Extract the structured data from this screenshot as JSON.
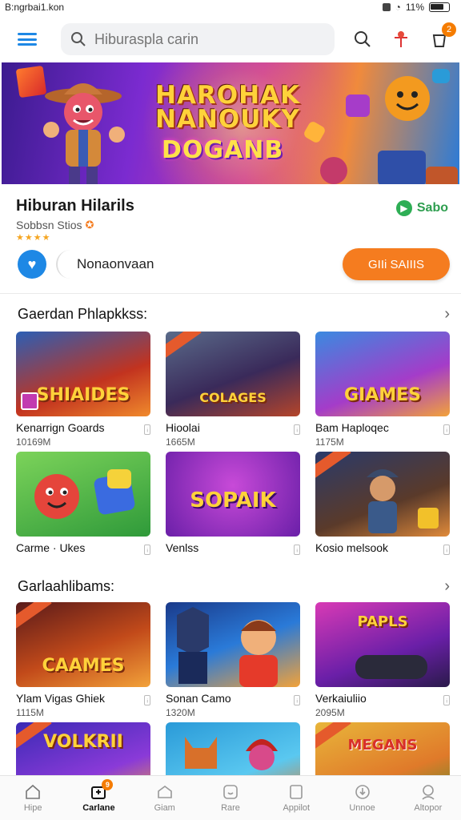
{
  "status_bar": {
    "left_text": "B:ngrbai1.kon",
    "battery": "11%"
  },
  "app_bar": {
    "search_placeholder": "Hiburaspla carin",
    "cart_badge": "2"
  },
  "banner": {
    "title_line1": "HAROHAK",
    "title_line2": "NANOUKY",
    "subtitle": "DOGANB"
  },
  "app": {
    "title": "Hiburan Hilarils",
    "subtitle": "Sobbsn Stios",
    "price": "Sabo",
    "secondary_label": "Nonaonvaan",
    "get_label": "GIIi SAIIIS"
  },
  "sections": [
    {
      "title": "Gaerdan Phlapkkss:",
      "items": [
        {
          "name": "Kenarrign Goards",
          "size": "10169M",
          "thumb_text": "SHIAIDES"
        },
        {
          "name": "Hioolai",
          "size": "1665M",
          "thumb_text": "COLAGES"
        },
        {
          "name": "Bam Haploqec",
          "size": "1175M",
          "thumb_text": "GIAMES"
        },
        {
          "name": "Carme · Ukes",
          "size": "",
          "thumb_text": ""
        },
        {
          "name": "Venlss",
          "size": "",
          "thumb_text": "SOPAIK"
        },
        {
          "name": "Kosio melsook",
          "size": "",
          "thumb_text": ""
        }
      ]
    },
    {
      "title": "Garlaahlibams:",
      "items": [
        {
          "name": "Ylam Vigas Ghiek",
          "size": "1115M",
          "thumb_text": "CAAMES"
        },
        {
          "name": "Sonan Camo",
          "size": "1320M",
          "thumb_text": ""
        },
        {
          "name": "Verkaiuliio",
          "size": "2095M",
          "thumb_text": "PAPLS"
        },
        {
          "name": "",
          "size": "",
          "thumb_text": "VOLKRII"
        },
        {
          "name": "",
          "size": "",
          "thumb_text": ""
        },
        {
          "name": "",
          "size": "",
          "thumb_text": "MEGANS"
        }
      ]
    }
  ],
  "bottom_nav": [
    {
      "label": "Hipe",
      "icon": "home-icon"
    },
    {
      "label": "Carlane",
      "icon": "games-icon",
      "badge": "9"
    },
    {
      "label": "Giam",
      "icon": "apps-icon"
    },
    {
      "label": "Rare",
      "icon": "face-icon"
    },
    {
      "label": "Appilot",
      "icon": "bookmark-icon"
    },
    {
      "label": "Unnoe",
      "icon": "download-icon"
    },
    {
      "label": "Altopor",
      "icon": "profile-icon"
    }
  ],
  "colors": {
    "accent": "#1e88e5",
    "cta": "#f57c1f",
    "price": "#2e9e4f"
  }
}
